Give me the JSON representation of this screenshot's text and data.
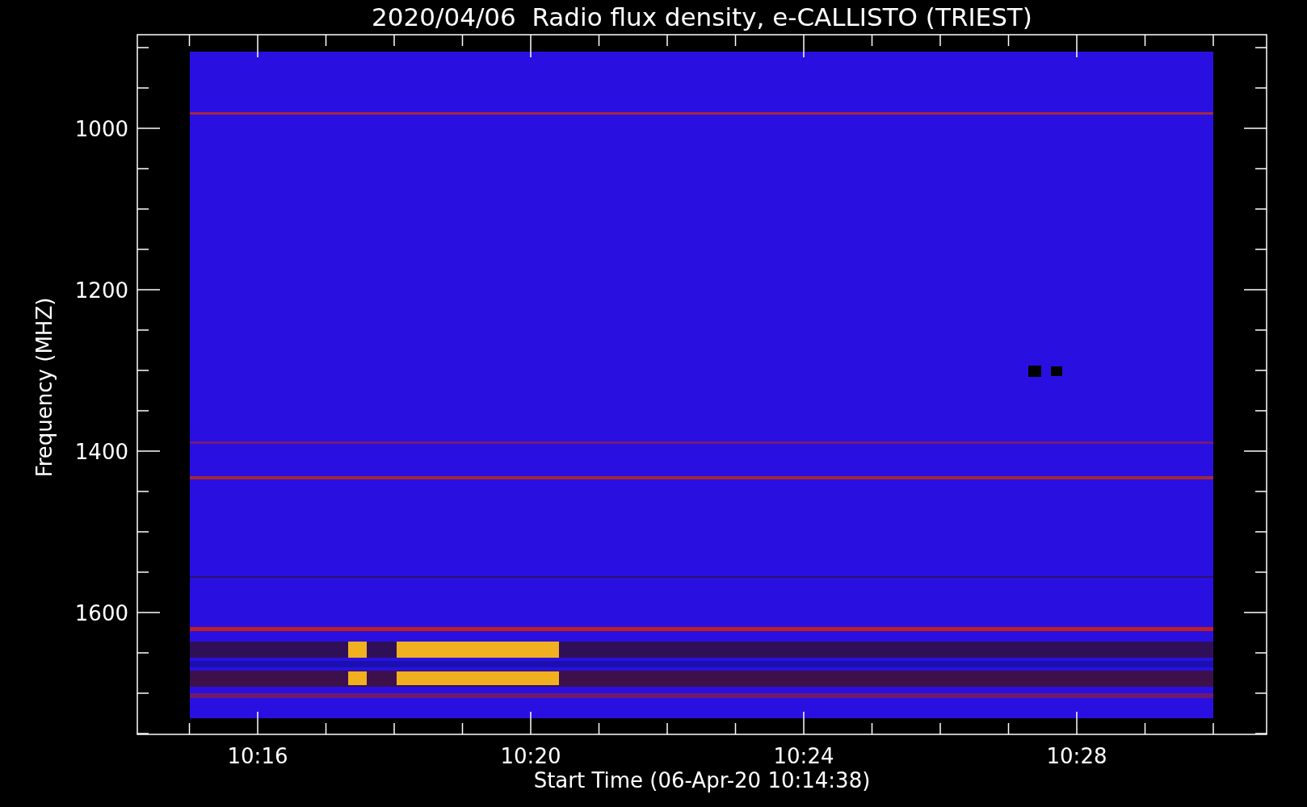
{
  "title": "2020/04/06  Radio flux density, e-CALLISTO (TRIEST)",
  "y_axis": {
    "label": "Frequency (MHZ)",
    "ticks": [
      "1000",
      "1200",
      "1400",
      "1600"
    ]
  },
  "x_axis": {
    "label": "Start Time (06-Apr-20 10:14:38)",
    "ticks": [
      "10:16",
      "10:20",
      "10:24",
      "10:28"
    ]
  }
}
